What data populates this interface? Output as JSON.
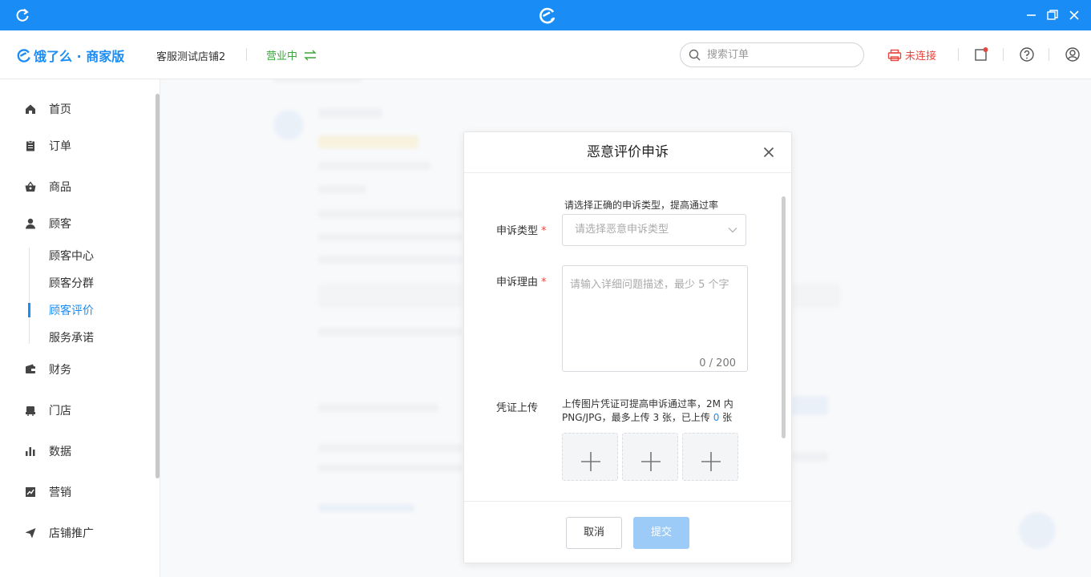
{
  "brand": {
    "name": "饿了么 · 商家版",
    "color": "#1a8cf5"
  },
  "header": {
    "store_name": "客服测试店铺2",
    "status": "营业中",
    "search_placeholder": "搜索订单",
    "printer_status": "未连接"
  },
  "sidebar": {
    "items": [
      {
        "label": "首页",
        "icon": "home-icon"
      },
      {
        "label": "订单",
        "icon": "clipboard-icon"
      },
      {
        "label": "商品",
        "icon": "basket-icon"
      },
      {
        "label": "顾客",
        "icon": "user-icon"
      },
      {
        "label": "财务",
        "icon": "wallet-icon"
      },
      {
        "label": "门店",
        "icon": "store-icon"
      },
      {
        "label": "数据",
        "icon": "bar-chart-icon"
      },
      {
        "label": "营销",
        "icon": "line-chart-icon"
      },
      {
        "label": "店铺推广",
        "icon": "send-icon"
      }
    ],
    "sub_items": [
      {
        "label": "顾客中心"
      },
      {
        "label": "顾客分群"
      },
      {
        "label": "顾客评价",
        "active": true
      },
      {
        "label": "服务承诺"
      }
    ]
  },
  "modal": {
    "title": "恶意评价申诉",
    "hint": "请选择正确的申诉类型，提高通过率",
    "type_label": "申诉类型",
    "type_placeholder": "请选择恶意申诉类型",
    "reason_label": "申诉理由",
    "reason_placeholder": "请输入详细问题描述，最少 5 个字",
    "reason_count": "0 / 200",
    "upload_label": "凭证上传",
    "upload_desc_line1": "上传图片凭证可提高申诉通过率，2M 内",
    "upload_desc_line2_pre": "PNG/JPG，最多上传 3 张，已上传 ",
    "upload_count": "0",
    "upload_desc_line2_post": " 张",
    "cancel_label": "取消",
    "submit_label": "提交"
  }
}
